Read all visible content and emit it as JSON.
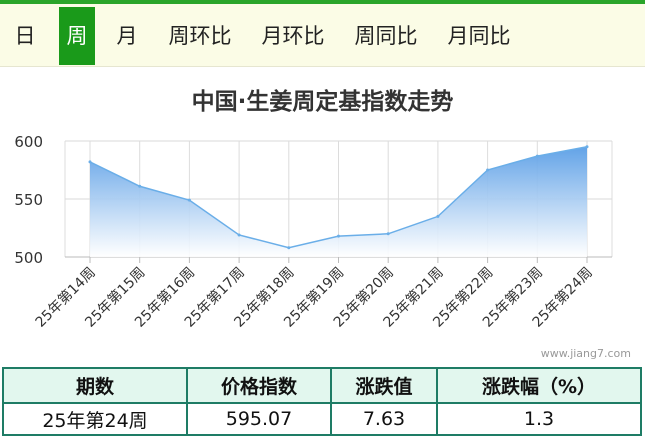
{
  "tabs": [
    {
      "label": "日",
      "active": false
    },
    {
      "label": "周",
      "active": true
    },
    {
      "label": "月",
      "active": false
    },
    {
      "label": "周环比",
      "active": false
    },
    {
      "label": "月环比",
      "active": false
    },
    {
      "label": "周同比",
      "active": false
    },
    {
      "label": "月同比",
      "active": false
    }
  ],
  "watermark": "www.jiang7.com",
  "colors": {
    "accent": "#1a9a1a",
    "area_top": "#5a9ee6",
    "line": "#6aaee8",
    "table_border": "#1e7c65",
    "header_bg": "#e2f7ee"
  },
  "chart_data": {
    "type": "area",
    "title": "中国·生姜周定基指数走势",
    "xlabel": "",
    "ylabel": "",
    "categories": [
      "25年第14周",
      "25年第15周",
      "25年第16周",
      "25年第17周",
      "25年第18周",
      "25年第19周",
      "25年第20周",
      "25年第21周",
      "25年第22周",
      "25年第23周",
      "25年第24周"
    ],
    "series": [
      {
        "values": [
          582,
          561,
          549,
          519,
          508,
          518,
          520,
          535,
          575,
          587,
          595.07
        ]
      }
    ],
    "ylim": [
      500,
      600
    ],
    "yticks": [
      500,
      550,
      600
    ],
    "grid": true
  },
  "table": {
    "headers": [
      "期数",
      "价格指数",
      "涨跌值",
      "涨跌幅（%）"
    ],
    "row": [
      "25年第24周",
      "595.07",
      "7.63",
      "1.3"
    ]
  }
}
